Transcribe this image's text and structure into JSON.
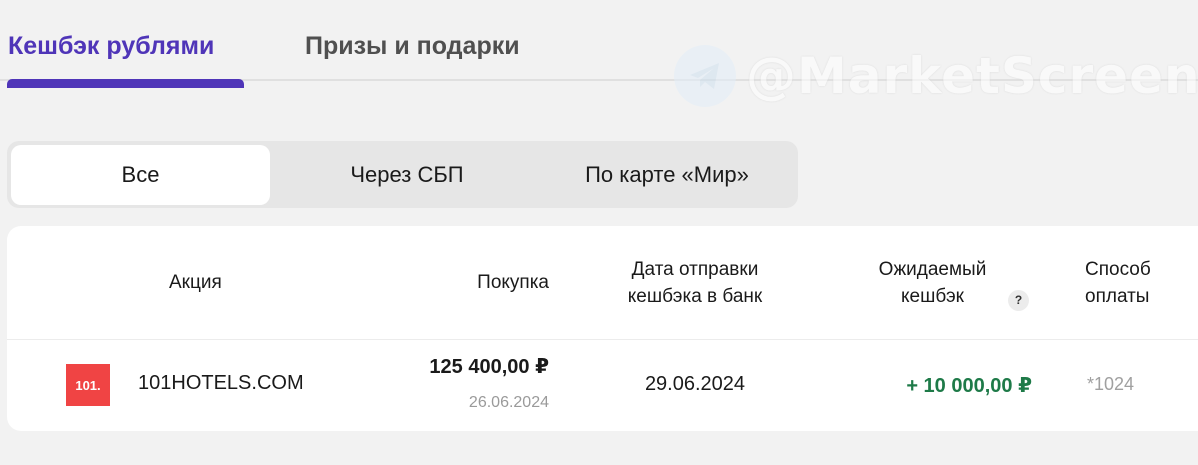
{
  "tabs": {
    "cashback_label": "Кешбэк рублями",
    "prizes_label": "Призы и подарки"
  },
  "watermark": {
    "text": "@MarketScreen",
    "icon": "telegram-icon"
  },
  "filters": {
    "all": "Все",
    "sbp": "Через СБП",
    "mir": "По карте «Мир»",
    "selected": "Все"
  },
  "table": {
    "headers": {
      "action": "Акция",
      "purchase": "Покупка",
      "date_line1": "Дата отправки",
      "date_line2": "кешбэка в банк",
      "expected_line1": "Ожидаемый",
      "expected_line2": "кешбэк",
      "help": "?",
      "method_line1": "Способ",
      "method_line2": "оплаты"
    },
    "rows": [
      {
        "logo_text": "101.",
        "merchant": "101HOTELS.COM",
        "amount": "125 400,00 ₽",
        "purchase_date": "26.06.2024",
        "send_date": "29.06.2024",
        "cashback": "+ 10 000,00 ₽",
        "payment": "*1024"
      }
    ]
  },
  "colors": {
    "accent": "#4f35b8",
    "cashback_green": "#1e7a48",
    "logo_red": "#f04444",
    "background": "#f2f2f2"
  }
}
